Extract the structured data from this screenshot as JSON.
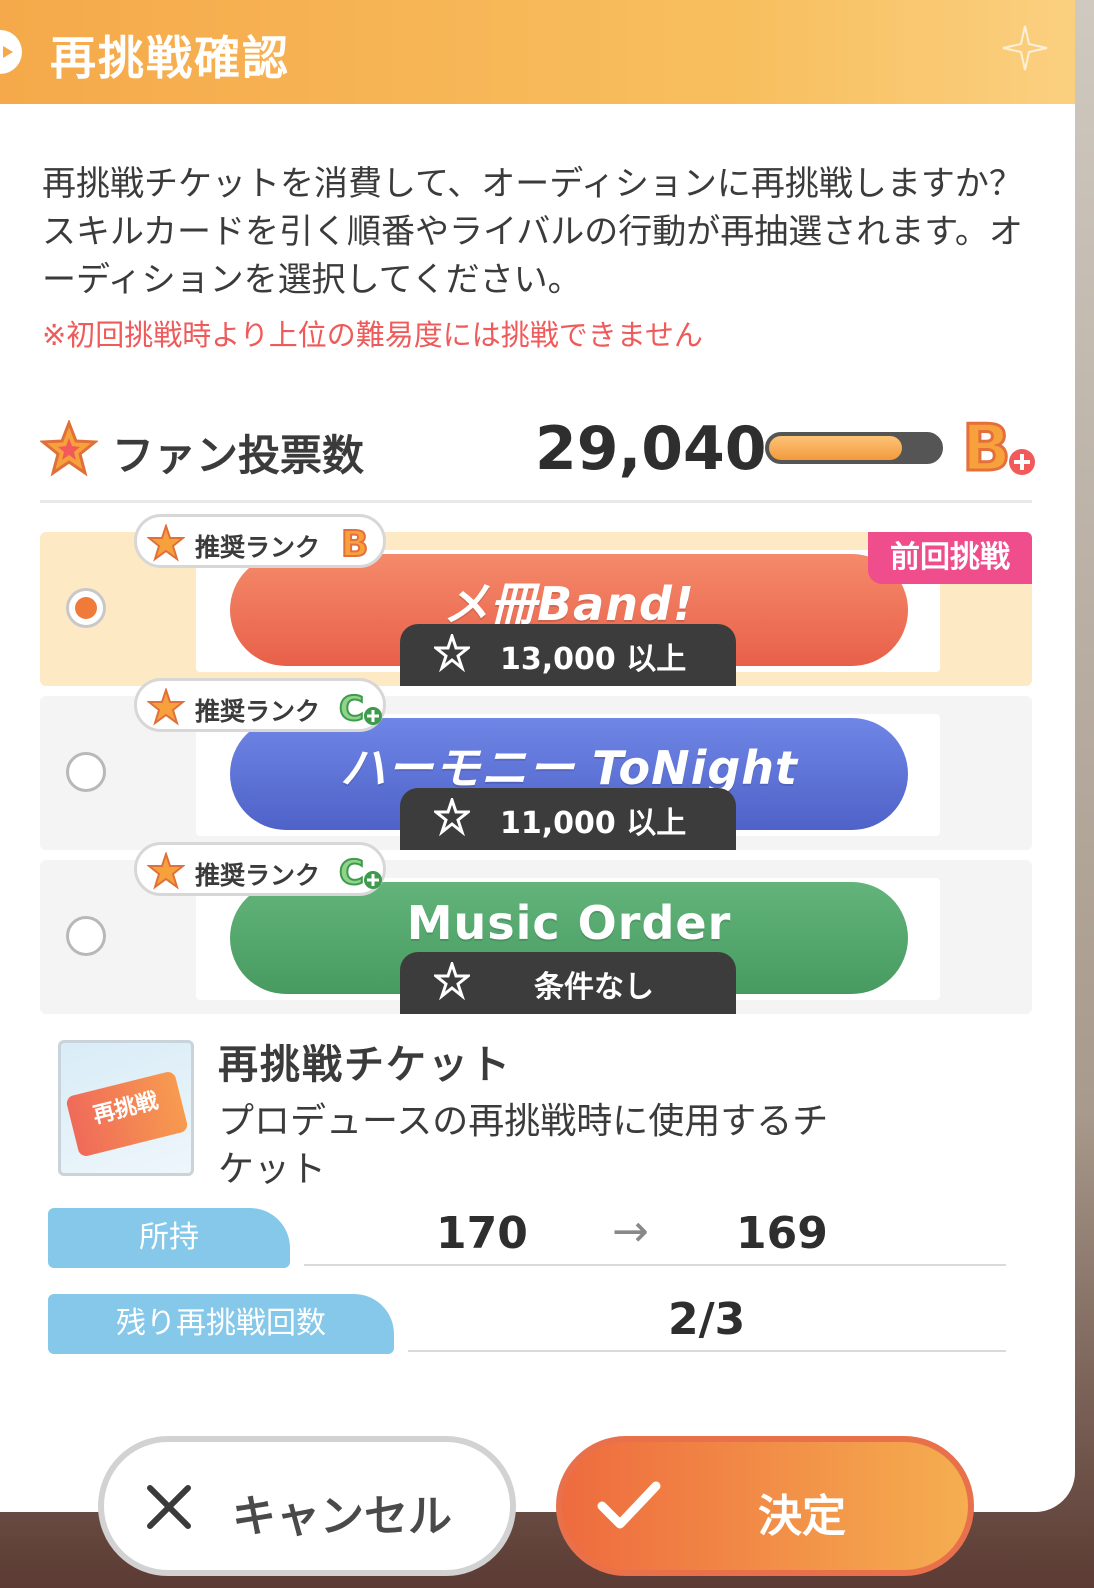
{
  "header": {
    "title": "再挑戦確認"
  },
  "description": "再挑戦チケットを消費して、オーディションに再挑戦しますか？スキルカードを引く順番やライバルの行動が再抽選されます。オーディションを選択してください。",
  "warning": "※初回挑戦時より上位の難易度には挑戦できません",
  "fan_votes": {
    "label": "ファン投票数",
    "value": "29,040",
    "progress": 0.78,
    "rank": "B+"
  },
  "auditions": [
    {
      "title": "メ冊Band!",
      "rank_label": "推奨ランク",
      "rank": "B",
      "condition": "13,000 以上",
      "selected": true,
      "tag": "前回挑戦",
      "color": "#ee6d4e"
    },
    {
      "title": "ハーモニー ToNight",
      "rank_label": "推奨ランク",
      "rank": "C+",
      "condition": "11,000 以上",
      "selected": false,
      "color": "#5a73d8"
    },
    {
      "title": "Music Order",
      "rank_label": "推奨ランク",
      "rank": "C+",
      "condition": "条件なし",
      "selected": false,
      "color": "#4fa86a"
    }
  ],
  "ticket": {
    "name": "再挑戦チケット",
    "image_text": "再挑戦",
    "description": "プロデュースの再挑戦時に使用するチケット"
  },
  "stats": {
    "owned_label": "所持",
    "owned_before": "170",
    "owned_after": "169",
    "arrow": "→",
    "remaining_label": "残り再挑戦回数",
    "remaining_value": "2/3"
  },
  "buttons": {
    "cancel_label": "キャンセル",
    "confirm_label": "決定"
  },
  "colors": {
    "accent_orange": "#f5a94a",
    "selected_bg": "#fde9c4",
    "warning": "#ef5a5a",
    "tag": "#ef4d8c",
    "stat_label": "#86c8ea"
  }
}
